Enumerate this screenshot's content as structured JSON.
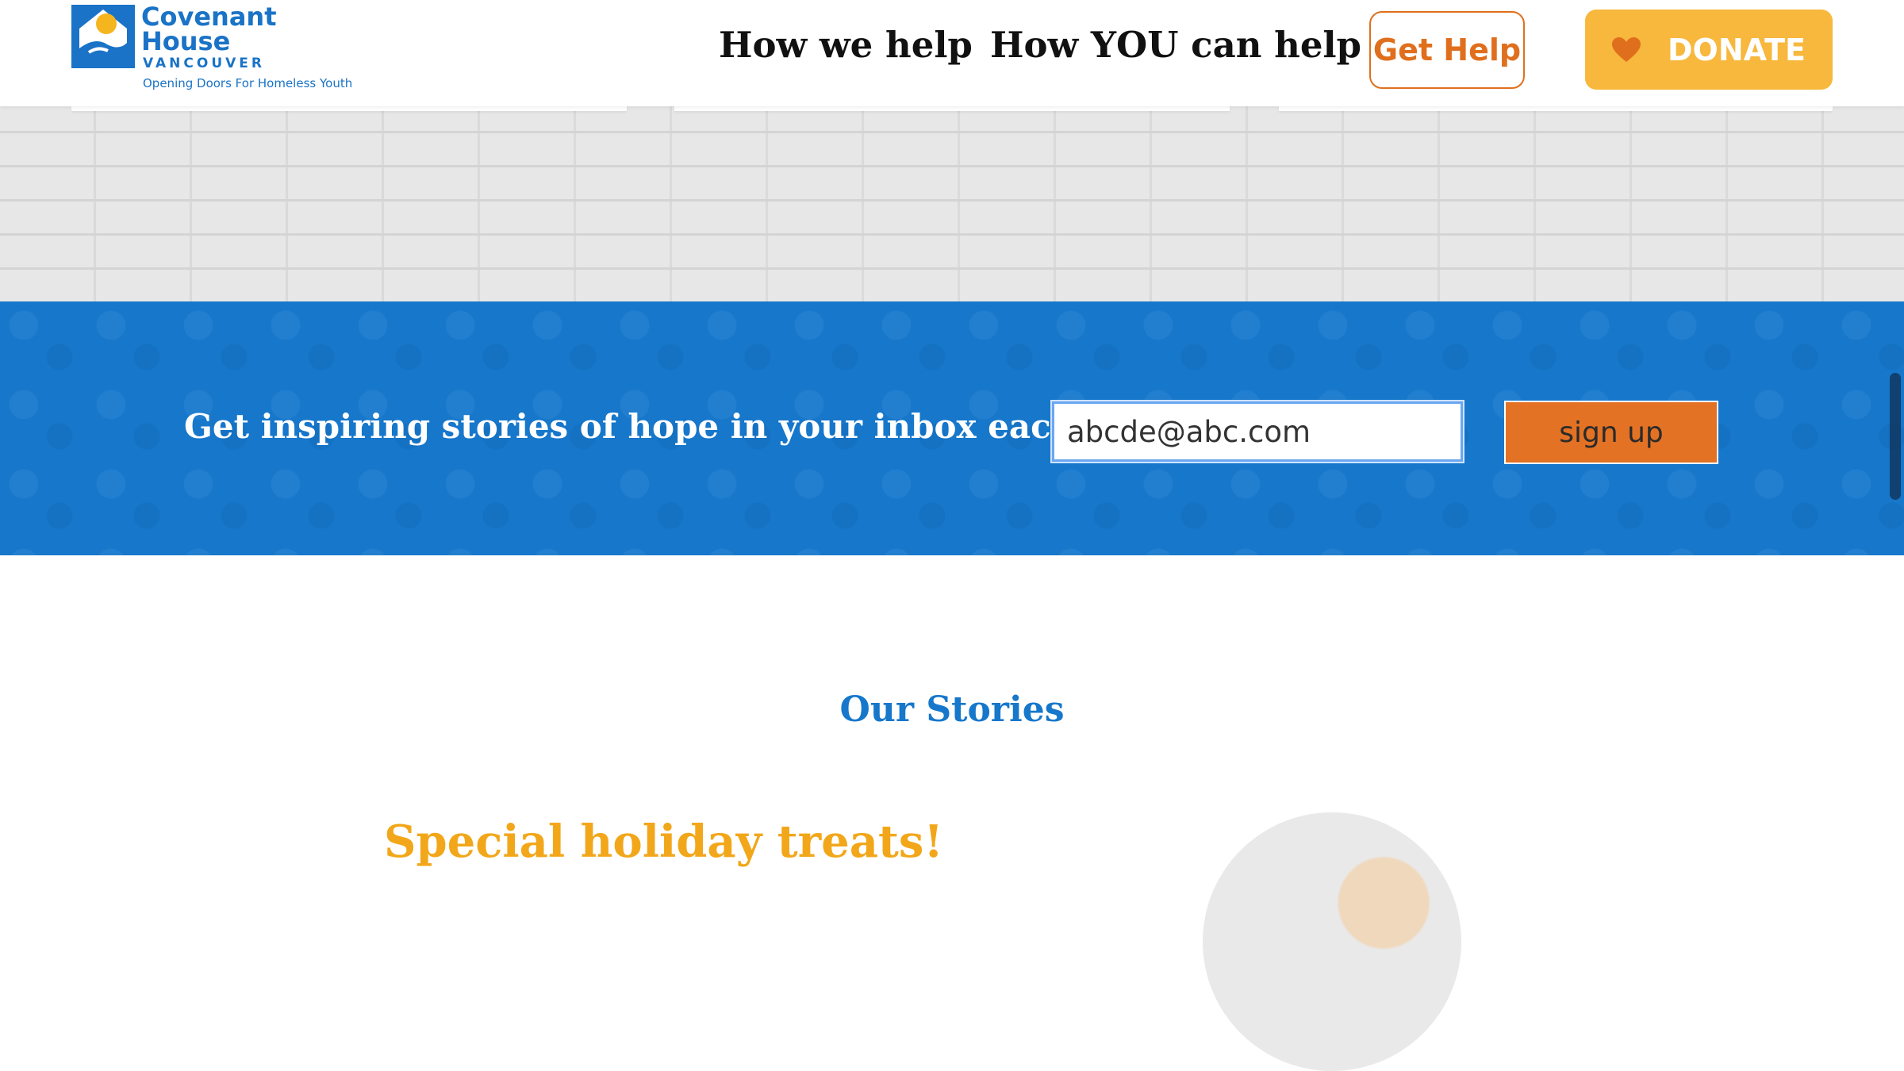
{
  "header": {
    "logo": {
      "name": "Covenant House",
      "city": "VANCOUVER",
      "tagline": "Opening Doors For Homeless Youth"
    },
    "nav": [
      {
        "label": "How we help"
      },
      {
        "label": "How YOU can help"
      }
    ],
    "get_help_label": "Get Help",
    "donate_label": "DONATE"
  },
  "newsletter": {
    "text": "Get inspiring stories of hope in your inbox each month",
    "email_value": "abcde@abc.com",
    "signup_label": "sign up"
  },
  "stories": {
    "heading": "Our Stories",
    "first_story_title": "Special holiday treats!"
  },
  "colors": {
    "brand_blue": "#1677cb",
    "brand_orange": "#e06f1d",
    "donate_yellow": "#f7b83d",
    "story_title_yellow": "#f2a71a"
  },
  "icons": {
    "logo": "covenant-house-logo",
    "donate": "heart-icon"
  }
}
